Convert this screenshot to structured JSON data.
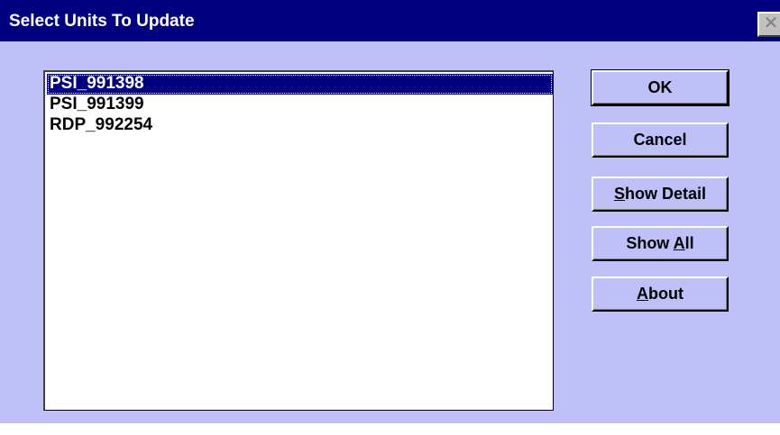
{
  "window": {
    "title": "Select Units To Update",
    "close_glyph": "✕"
  },
  "units_list": {
    "items": [
      "PSI_991398",
      "PSI_991399",
      "RDP_992254"
    ],
    "selected_index": 0
  },
  "buttons": {
    "ok": {
      "label": "OK"
    },
    "cancel": {
      "label": "Cancel"
    },
    "show_detail": {
      "label_accel": "S",
      "label_rest": "how Detail"
    },
    "show_all": {
      "label_pre": "Show ",
      "label_accel": "A",
      "label_rest": "ll"
    },
    "about": {
      "label_accel": "A",
      "label_rest": "bout"
    }
  },
  "colors": {
    "titlebar": "#000080",
    "dialog_background": "#c0c0f8",
    "selection": "#000080"
  }
}
